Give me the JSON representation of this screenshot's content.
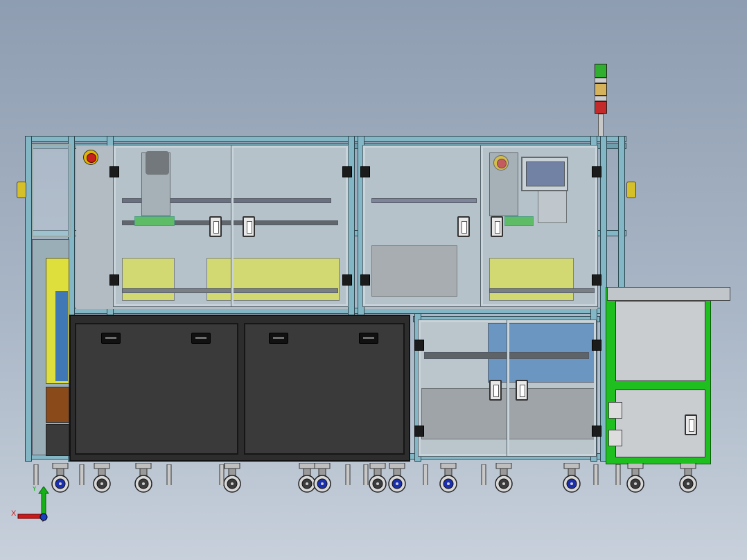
{
  "viewport": {
    "title": "",
    "background": "#9ca9ba"
  },
  "machine": {
    "frame_color": "#84b7c6",
    "accent_green": "#1fbf1f",
    "drawer_color": "#3a3a3a",
    "yellow_panel_color": "#dede3c",
    "blue_panel_color": "#3f78b5",
    "stack_light": [
      "#2fae2f",
      "#d6b35a",
      "#c42a2a"
    ],
    "icons": [
      "emergency-stop-icon",
      "hmi-screen-icon",
      "stack-light-icon",
      "caster-wheel-icon",
      "axis-triad-icon"
    ]
  },
  "triad": {
    "x_label": "X",
    "y_label": "Y"
  }
}
